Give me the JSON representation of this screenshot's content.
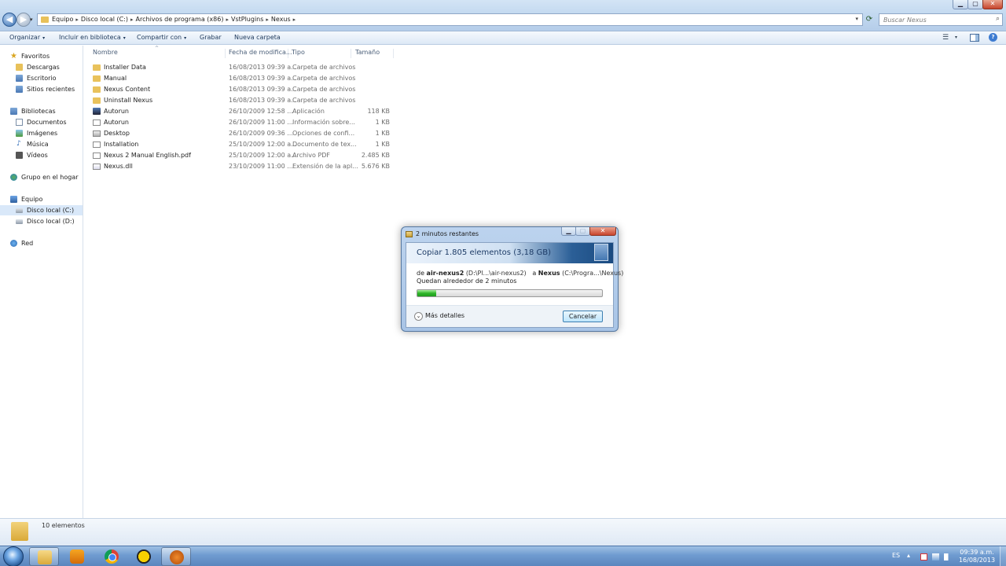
{
  "window": {
    "controls": {
      "minimize": "▁",
      "maximize": "▢",
      "close": "✕"
    }
  },
  "address_bar": {
    "back_glyph": "◀",
    "forward_glyph": "▶",
    "history_glyph": "▾",
    "breadcrumbs": [
      "Equipo",
      "Disco local (C:)",
      "Archivos de programa (x86)",
      "VstPlugins",
      "Nexus"
    ],
    "separator": "▸",
    "dropdown_glyph": "▾",
    "refresh_glyph": "⟳",
    "search_placeholder": "Buscar Nexus",
    "search_glyph": "⌕"
  },
  "command_bar": {
    "organize": "Organizar",
    "include_library": "Incluir en biblioteca",
    "share_with": "Compartir con",
    "burn": "Grabar",
    "new_folder": "Nueva carpeta",
    "dropdown_glyph": "▾",
    "views_glyph": "☰",
    "help_glyph": "?"
  },
  "nav_pane": {
    "favorites": {
      "label": "Favoritos",
      "items": [
        "Descargas",
        "Escritorio",
        "Sitios recientes"
      ]
    },
    "libraries": {
      "label": "Bibliotecas",
      "items": [
        "Documentos",
        "Imágenes",
        "Música",
        "Vídeos"
      ]
    },
    "homegroup": "Grupo en el hogar",
    "computer": {
      "label": "Equipo",
      "items": [
        "Disco local (C:)",
        "Disco local (D:)"
      ]
    },
    "network": "Red"
  },
  "file_list": {
    "columns": [
      "Nombre",
      "Fecha de modifica...",
      "Tipo",
      "Tamaño"
    ],
    "sort_glyph": "^",
    "rows": [
      {
        "name": "Installer Data",
        "date": "16/08/2013 09:39 a...",
        "type": "Carpeta de archivos",
        "size": "",
        "icon": "folder-icon"
      },
      {
        "name": "Manual",
        "date": "16/08/2013 09:39 a...",
        "type": "Carpeta de archivos",
        "size": "",
        "icon": "folder-icon"
      },
      {
        "name": "Nexus Content",
        "date": "16/08/2013 09:39 a...",
        "type": "Carpeta de archivos",
        "size": "",
        "icon": "folder-icon"
      },
      {
        "name": "Uninstall Nexus",
        "date": "16/08/2013 09:39 a...",
        "type": "Carpeta de archivos",
        "size": "",
        "icon": "folder-icon"
      },
      {
        "name": "Autorun",
        "date": "26/10/2009 12:58 ...",
        "type": "Aplicación",
        "size": "118 KB",
        "icon": "application-icon"
      },
      {
        "name": "Autorun",
        "date": "26/10/2009 11:00 ...",
        "type": "Información sobre...",
        "size": "1 KB",
        "icon": "setup-info-icon"
      },
      {
        "name": "Desktop",
        "date": "26/10/2009 09:36 ...",
        "type": "Opciones de confi...",
        "size": "1 KB",
        "icon": "config-file-icon"
      },
      {
        "name": "Installation",
        "date": "25/10/2009 12:00 a...",
        "type": "Documento de tex...",
        "size": "1 KB",
        "icon": "text-document-icon"
      },
      {
        "name": "Nexus 2 Manual English.pdf",
        "date": "25/10/2009 12:00 a...",
        "type": "Archivo PDF",
        "size": "2.485 KB",
        "icon": "pdf-file-icon"
      },
      {
        "name": "Nexus.dll",
        "date": "23/10/2009 11:00 ...",
        "type": "Extensión de la apl...",
        "size": "5.676 KB",
        "icon": "dll-file-icon"
      }
    ]
  },
  "status_bar": {
    "text": "10 elementos"
  },
  "copy_dialog": {
    "title": "2 minutos restantes",
    "heading": "Copiar 1.805 elementos (3,18 GB)",
    "from_prefix": "de",
    "source_name": "air-nexus2",
    "source_path": "(D:\\Pl...\\air-nexus2)",
    "to_prefix": "a",
    "dest_name": "Nexus",
    "dest_path": "(C:\\Progra...\\Nexus)",
    "remaining": "Quedan alrededor de 2 minutos",
    "progress_fraction": 0.1,
    "more_details": "Más detalles",
    "more_glyph": "⌄",
    "cancel": "Cancelar",
    "controls": {
      "minimize": "▁",
      "maximize": "▢",
      "close": "✕"
    }
  },
  "taskbar": {
    "apps": [
      "windows-explorer",
      "media-player",
      "google-chrome",
      "norton",
      "fl-studio"
    ],
    "language": "ES",
    "tray_arrow": "▴",
    "clock_time": "09:39 a.m.",
    "clock_date": "16/08/2013"
  }
}
